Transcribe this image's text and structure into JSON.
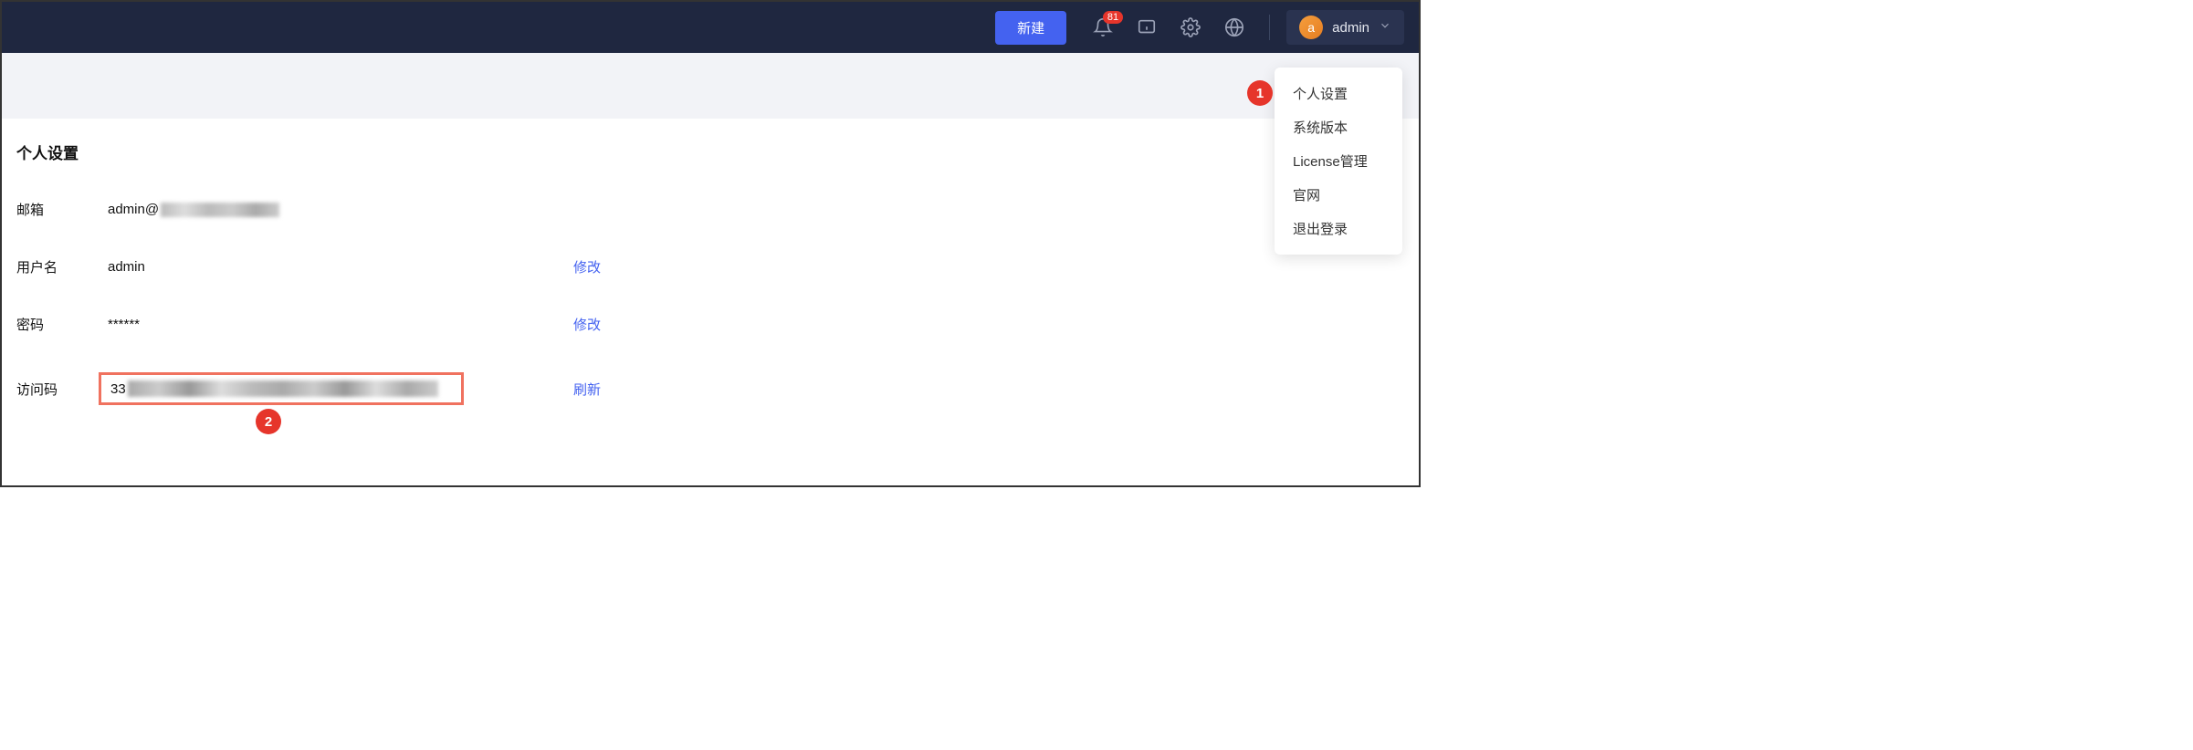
{
  "header": {
    "new_button": "新建",
    "notification_badge": "81",
    "username": "admin",
    "avatar_letter": "a"
  },
  "dropdown": {
    "items": [
      "个人设置",
      "系统版本",
      "License管理",
      "官网",
      "退出登录"
    ]
  },
  "page": {
    "title": "个人设置",
    "fields": {
      "email_label": "邮箱",
      "email_prefix": "admin@",
      "username_label": "用户名",
      "username_value": "admin",
      "username_action": "修改",
      "password_label": "密码",
      "password_value": "******",
      "password_action": "修改",
      "access_label": "访问码",
      "access_prefix": "33",
      "access_action": "刷新"
    }
  },
  "annotations": {
    "one": "1",
    "two": "2"
  }
}
